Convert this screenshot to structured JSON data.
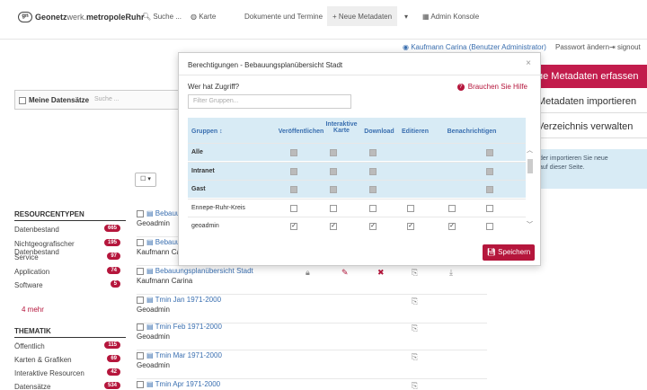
{
  "nav": {
    "brand_prefix": "Geonetz",
    "brand_mid": "werk.",
    "brand_suffix": "metropoleRuhr",
    "logo_text": "gn",
    "suche": "Suche ...",
    "karte": "Karte",
    "dokumente": "Dokumente und Termine",
    "neue_metadaten": "Neue Metadaten",
    "dropdown_caret": "▾",
    "admin": "Admin Konsole",
    "user": "Kaufmann Carina (Benutzer Administrator)",
    "passwort": "Passwort ändern",
    "signout": "signout"
  },
  "left": {
    "meine_datensaetze": "Meine Datensätze",
    "suche_placeholder": "Suche ...",
    "dd_button": "☐ ▾",
    "resourcentypen_title": "RESOURCENTYPEN",
    "resourcentypen": [
      {
        "label": "Datenbestand",
        "count": "665"
      },
      {
        "label": "Nichtgeografischer Datenbestand",
        "count": "195"
      },
      {
        "label": "Service",
        "count": "97"
      },
      {
        "label": "Application",
        "count": "74"
      },
      {
        "label": "Software",
        "count": "5"
      }
    ],
    "mehr": "4 mehr",
    "thematik_title": "THEMATIK",
    "thematik": [
      {
        "label": "Öffentlich",
        "count": "115"
      },
      {
        "label": "Karten & Grafiken",
        "count": "69"
      },
      {
        "label": "Interaktive Resourcen",
        "count": "42"
      },
      {
        "label": "Datensätze",
        "count": "534"
      }
    ]
  },
  "results": [
    {
      "title": "Bebauun",
      "owner": "Geoadmin"
    },
    {
      "title": "Bebauun",
      "owner": "Kaufmann Car"
    },
    {
      "title": "Bebauungsplanübersicht Stadt",
      "owner": "Kaufmann Carina"
    },
    {
      "title": "Tmin Jan 1971-2000",
      "owner": "Geoadmin"
    },
    {
      "title": "Tmin Feb 1971-2000",
      "owner": "Geoadmin"
    },
    {
      "title": "Tmin Mar 1971-2000",
      "owner": "Geoadmin"
    },
    {
      "title": "Tmin Apr 1971-2000",
      "owner": ""
    }
  ],
  "right": {
    "neue_metadaten_erfassen": "ue Metadaten erfassen",
    "metadaten_importieren": "Metadaten importieren",
    "verzeichnis_verwalten": "Verzeichnis verwalten",
    "info_line1": "der importieren Sie neue",
    "info_line2": "auf dieser Seite."
  },
  "modal": {
    "title": "Berechtigungen - Bebauungsplanübersicht Stadt",
    "close": "×",
    "wer_hat_zugriff": "Wer hat Zugriff?",
    "help": "Brauchen Sie Hilfe",
    "filter_placeholder": "Filter Gruppen...",
    "headers": {
      "gruppen": "Gruppen",
      "veroeffentlichen": "Veröffentlichen",
      "interaktive_karte_1": "Interaktive",
      "interaktive_karte_2": "Karte",
      "download": "Download",
      "editieren": "Editieren",
      "benachrichtigen": "Benachrichtigen"
    },
    "rows": [
      {
        "group": "Alle",
        "states": [
          "dis",
          "dis",
          "dis",
          "none",
          "none",
          "dis"
        ]
      },
      {
        "group": "Intranet",
        "states": [
          "dis",
          "dis",
          "dis",
          "none",
          "none",
          "dis"
        ]
      },
      {
        "group": "Gast",
        "states": [
          "dis",
          "dis",
          "dis",
          "none",
          "none",
          "dis"
        ]
      },
      {
        "group": "Ennepe-Ruhr-Kreis",
        "states": [
          "off",
          "off",
          "off",
          "off",
          "off",
          "off"
        ]
      },
      {
        "group": "geoadmin",
        "states": [
          "on",
          "on",
          "on",
          "on",
          "on",
          "off"
        ]
      }
    ],
    "check_mark": "✓",
    "save": "Speichern"
  }
}
